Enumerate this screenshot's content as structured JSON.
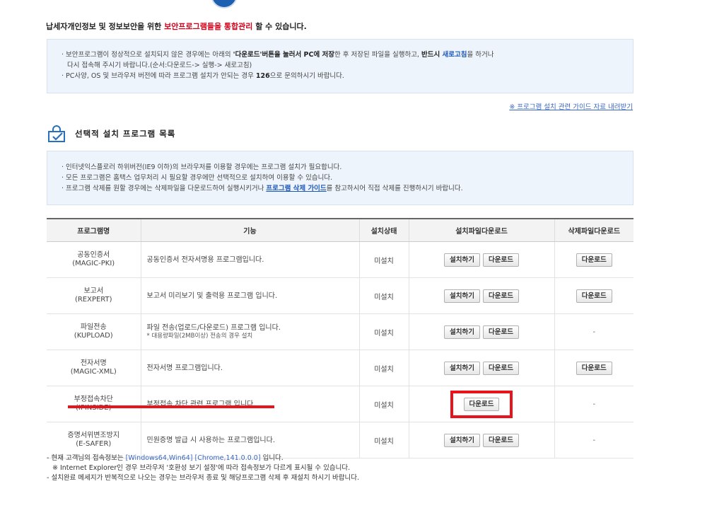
{
  "headline": {
    "part1": "납세자개인정보 및 정보보안을 위한 ",
    "red": "보안프로그램들을 통합관리",
    "part2": " 할 수 있습니다."
  },
  "notice1": {
    "l1a": "· 보안프로그램이 정상적으로 설치되지 않은 경우에는 아래의 ",
    "l1b": "'다운로드'버튼을 눌러서 PC에 저장",
    "l1c": "한 후 저장된 파일을 실행하고, ",
    "l1d": "반드시 ",
    "l1e": "새로고침",
    "l1f": "을 하거나",
    "l2": "다시 접속해 주시기 바랍니다.(순서:다운로드-> 실행-> 새로고침)",
    "l3a": "· PC사양, OS 및 브라우저 버전에 따라 프로그램 설치가 안되는 경우 ",
    "l3b": "126",
    "l3c": "으로 문의하시기 바랍니다."
  },
  "guide_link": "※ 프로그램 설치 관련 가이드 자료 내려받기",
  "section_title": "선택적 설치 프로그램 목록",
  "notice2": {
    "l1": "· 인터넷익스플로러 하위버전(IE9 이하)의 브라우저를 이용할 경우에는 프로그램 설치가 필요합니다.",
    "l2": "· 모든 프로그램은 홈택스 업무처리 시 필요할 경우에만 선택적으로 설치하여 이용할 수 있습니다.",
    "l3a": "· 프로그램 삭제를 원할 경우에는 삭제파일을 다운로드하여 실행시키거나 ",
    "l3b": "프로그램 삭제 가이드",
    "l3c": "를 참고하시어 직접 삭제를 진행하시기 바랍니다."
  },
  "table": {
    "headers": [
      "프로그램명",
      "기능",
      "설치상태",
      "설치파일다운로드",
      "삭제파일다운로드"
    ],
    "install_label": "설치하기",
    "download_label": "다운로드",
    "dash": "-",
    "rows": [
      {
        "name": "공동인증서",
        "code": "(MAGIC-PKI)",
        "func": "공동인증서 전자서명용 프로그램입니다.",
        "status": "미설치"
      },
      {
        "name": "보고서",
        "code": "(REXPERT)",
        "func": "보고서 미리보기 및 출력용 프로그램 입니다.",
        "status": "미설치"
      },
      {
        "name": "파일전송",
        "code": "(KUPLOAD)",
        "func": "파일 전송(업로드/다운로드) 프로그램 입니다.",
        "func_sub": "* 대용량파일(2MB이상) 전송의 경우 설치",
        "status": "미설치"
      },
      {
        "name": "전자서명",
        "code": "(MAGIC-XML)",
        "func": "전자서명 프로그램입니다.",
        "status": "미설치"
      },
      {
        "name": "부정접속차단",
        "code": "(IPINSIDE)",
        "func": "부정접속 차단 관련 프로그램 입니다.",
        "status": "미설치"
      },
      {
        "name": "증명서위변조방지",
        "code": "(E-SAFER)",
        "func": "민원증명 발급 시 사용하는 프로그램입니다.",
        "status": "미설치"
      }
    ]
  },
  "footer": {
    "l1a": "- 현재 고객님의 접속정보는 ",
    "l1b": "[Windows64,Win64] [Chrome,141.0.0.0]",
    "l1c": " 입니다.",
    "l2": "※ Internet Explorer인 경우 브라우저 '호환성 보기 설정'에 따라 접속정보가 다르게 표시될 수 있습니다.",
    "l3": "- 설치완료 메세지가 반복적으로 나오는 경우는 브라우저 종료 및 해당프로그램 삭제 후 재설치 하시기 바랍니다."
  }
}
